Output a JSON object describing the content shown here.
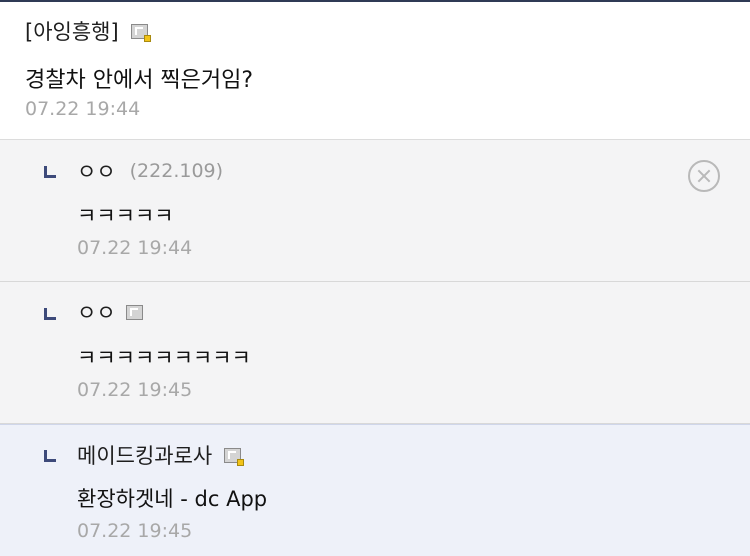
{
  "main_comment": {
    "name": "[아잉흥행]",
    "text": "경찰차 안에서 찍은거임?",
    "date": "07.22 19:44"
  },
  "replies": [
    {
      "name": "ㅇㅇ",
      "ip": "(222.109)",
      "text": "ㅋㅋㅋㅋㅋ",
      "date": "07.22 19:44",
      "icon": "delete-icon"
    },
    {
      "name": "ㅇㅇ",
      "text": "ㅋㅋㅋㅋㅋㅋㅋㅋㅋ",
      "date": "07.22 19:45",
      "icon": "gallog-icon"
    },
    {
      "name": "메이드킹과로사",
      "text": "환장하겟네 - dc App",
      "date": "07.22 19:45",
      "icon": "gallog-icon"
    }
  ],
  "colors": {
    "accent": "#3d4a7a",
    "date": "#a8a8a8",
    "reply_bg": "#f4f4f5",
    "highlight_bg": "#eef1f9"
  }
}
